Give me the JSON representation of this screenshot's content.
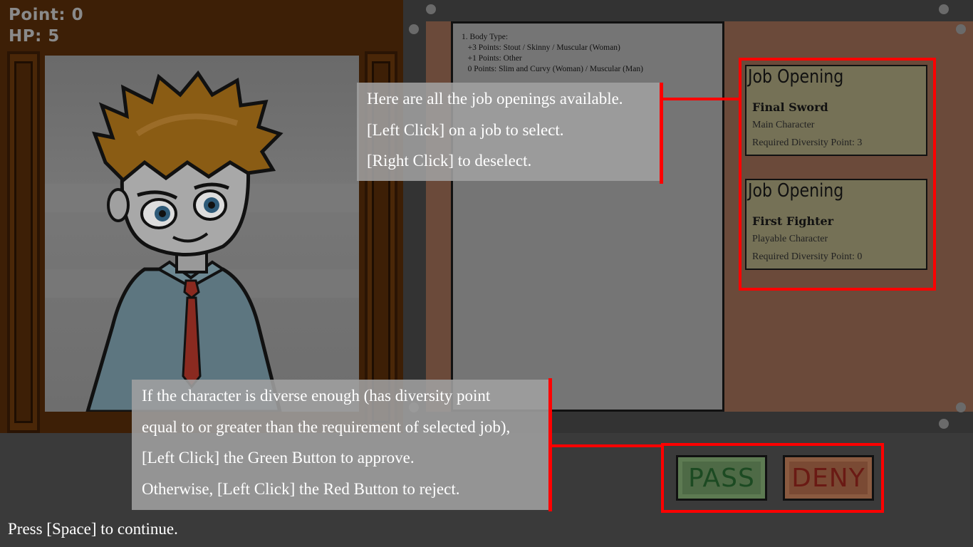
{
  "hud": {
    "point": "Point: 0",
    "hp": "HP: 5"
  },
  "applicant_doc": {
    "lines": [
      "1. Body Type:",
      "   +3 Points: Stout / Skinny / Muscular (Woman)",
      "   +1 Points: Other",
      "   0 Points: Slim and Curvy (Woman) / Muscular (Man)"
    ]
  },
  "jobs": [
    {
      "header": "Job Opening",
      "name": "Final Sword",
      "role": "Main Character",
      "requirement": "Required Diversity Point: 3"
    },
    {
      "header": "Job Opening",
      "name": "First Fighter",
      "role": "Playable Character",
      "requirement": "Required Diversity Point: 0"
    }
  ],
  "buttons": {
    "pass": "PASS",
    "deny": "DENY"
  },
  "tutorial": {
    "jobs_tip": [
      "Here are all the job openings available.",
      "[Left Click] on a job to select.",
      "[Right Click] to deselect."
    ],
    "buttons_tip": [
      "If the character is diverse enough (has diversity point",
      "equal to or greater than the requirement of selected job),",
      "[Left Click] the Green Button to approve.",
      "Otherwise, [Left Click] the Red Button to reject."
    ],
    "continue": "Press [Space] to continue."
  },
  "colors": {
    "highlight": "#ff0000",
    "pass_button": "#4e6a46",
    "deny_button": "#7a4a34",
    "job_card": "#757156"
  }
}
